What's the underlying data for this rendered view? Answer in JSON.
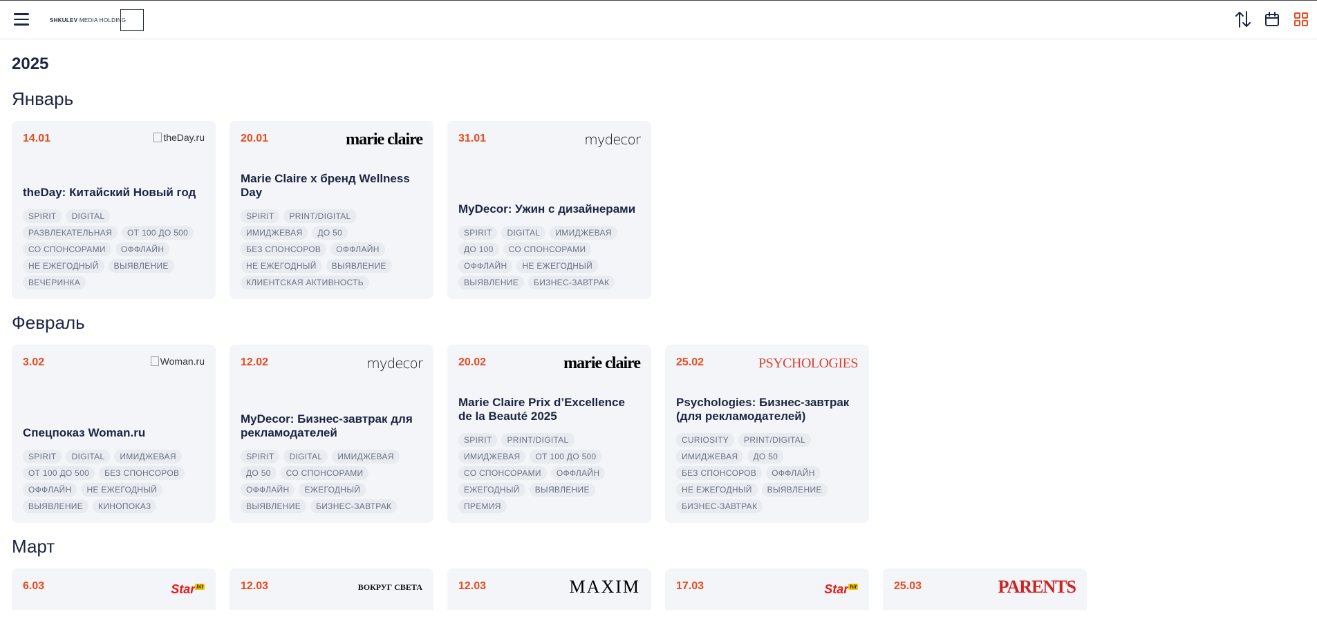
{
  "header": {
    "logo_bold": "SHKULEV",
    "logo_rest": " MEDIA HOLDING",
    "icons": [
      "menu-icon",
      "sort-icon",
      "calendar-icon",
      "grid-icon"
    ]
  },
  "year": "2025",
  "months": [
    {
      "name": "Январь",
      "events": [
        {
          "date": "14.01",
          "brand": "theDay.ru",
          "title": "theDay: Китайский Новый год",
          "tags": [
            "SPIRIT",
            "DIGITAL",
            "РАЗВЛЕКАТЕЛЬНАЯ",
            "ОТ 100 ДО 500",
            "СО СПОНСОРАМИ",
            "ОФФЛАЙН",
            "НЕ ЕЖЕГОДНЫЙ",
            "ВЫЯВЛЕНИЕ",
            "ВЕЧЕРИНКА"
          ]
        },
        {
          "date": "20.01",
          "brand": "marie claire",
          "title": "Marie Claire x бренд Wellness Day",
          "tags": [
            "SPIRIT",
            "PRINT/DIGITAL",
            "ИМИДЖЕВАЯ",
            "ДО 50",
            "БЕЗ СПОНСОРОВ",
            "ОФФЛАЙН",
            "НЕ ЕЖЕГОДНЫЙ",
            "ВЫЯВЛЕНИЕ",
            "КЛИЕНТСКАЯ АКТИВНОСТЬ"
          ]
        },
        {
          "date": "31.01",
          "brand": "mydecor",
          "title": "MyDecor: Ужин с дизайнерами",
          "tags": [
            "SPIRIT",
            "DIGITAL",
            "ИМИДЖЕВАЯ",
            "ДО 100",
            "СО СПОНСОРАМИ",
            "ОФФЛАЙН",
            "НЕ ЕЖЕГОДНЫЙ",
            "ВЫЯВЛЕНИЕ",
            "БИЗНЕС-ЗАВТРАК"
          ]
        }
      ]
    },
    {
      "name": "Февраль",
      "events": [
        {
          "date": "3.02",
          "brand": "Woman.ru",
          "title": "Спецпоказ Woman.ru",
          "tags": [
            "SPIRIT",
            "DIGITAL",
            "ИМИДЖЕВАЯ",
            "ОТ 100 ДО 500",
            "БЕЗ СПОНСОРОВ",
            "ОФФЛАЙН",
            "НЕ ЕЖЕГОДНЫЙ",
            "ВЫЯВЛЕНИЕ",
            "КИНОПОКАЗ"
          ]
        },
        {
          "date": "12.02",
          "brand": "mydecor",
          "title": "MyDecor: Бизнес-завтрак для рекламодателей",
          "tags": [
            "SPIRIT",
            "DIGITAL",
            "ИМИДЖЕВАЯ",
            "ДО 50",
            "СО СПОНСОРАМИ",
            "ОФФЛАЙН",
            "ЕЖЕГОДНЫЙ",
            "ВЫЯВЛЕНИЕ",
            "БИЗНЕС-ЗАВТРАК"
          ]
        },
        {
          "date": "20.02",
          "brand": "marie claire",
          "title": "Marie Claire Prix d’Excellence de la Beauté 2025",
          "tags": [
            "SPIRIT",
            "PRINT/DIGITAL",
            "ИМИДЖЕВАЯ",
            "ОТ 100 ДО 500",
            "СО СПОНСОРАМИ",
            "ОФФЛАЙН",
            "ЕЖЕГОДНЫЙ",
            "ВЫЯВЛЕНИЕ",
            "ПРЕМИЯ"
          ]
        },
        {
          "date": "25.02",
          "brand": "PSYCHOLOGIES",
          "title": "Psychologies: Бизнес-завтрак (для рекламодателей)",
          "tags": [
            "CURIOSITY",
            "PRINT/DIGITAL",
            "ИМИДЖЕВАЯ",
            "ДО 50",
            "БЕЗ СПОНСОРОВ",
            "ОФФЛАЙН",
            "НЕ ЕЖЕГОДНЫЙ",
            "ВЫЯВЛЕНИЕ",
            "БИЗНЕС-ЗАВТРАК"
          ]
        }
      ]
    },
    {
      "name": "Март",
      "events": [
        {
          "date": "6.03",
          "brand": "Star",
          "brand_sup": "hit"
        },
        {
          "date": "12.03",
          "brand": "ВОКРУГ СВЕТА"
        },
        {
          "date": "12.03",
          "brand": "MAXIM"
        },
        {
          "date": "17.03",
          "brand": "Star",
          "brand_sup": "hit"
        },
        {
          "date": "25.03",
          "brand": "PARENTS"
        }
      ]
    }
  ],
  "colors": {
    "accent": "#e94a1e",
    "text": "#1c2541",
    "card_bg": "#f3f5f8",
    "tag_bg": "#e8ebf0",
    "tag_text": "#6b7280"
  }
}
